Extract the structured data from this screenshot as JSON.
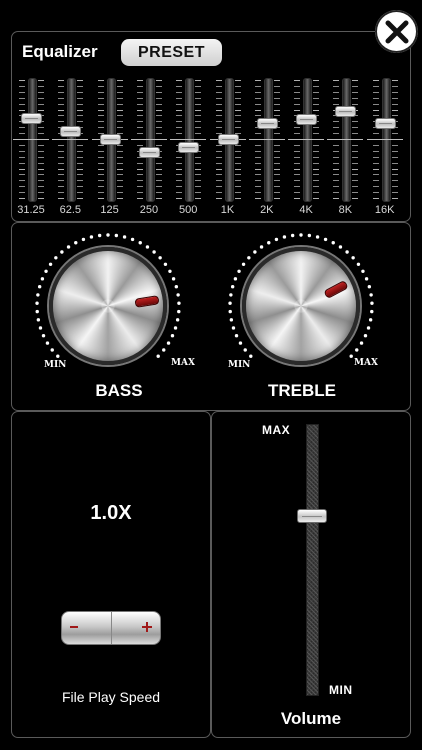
{
  "header": {
    "close_icon": "close-icon"
  },
  "equalizer": {
    "title": "Equalizer",
    "preset_label": "PRESET",
    "level_range": [
      -12,
      12
    ],
    "bands": [
      {
        "label": "31.25",
        "level": 4
      },
      {
        "label": "62.5",
        "level": 1.5
      },
      {
        "label": "125",
        "level": 0
      },
      {
        "label": "250",
        "level": -2.6
      },
      {
        "label": "500",
        "level": -1.6
      },
      {
        "label": "1K",
        "level": 0
      },
      {
        "label": "2K",
        "level": 3
      },
      {
        "label": "4K",
        "level": 3.8
      },
      {
        "label": "8K",
        "level": 5.5
      },
      {
        "label": "16K",
        "level": 3
      }
    ]
  },
  "bass": {
    "label": "BASS",
    "min_label": "MIN",
    "max_label": "MAX",
    "value": 0.8
  },
  "treble": {
    "label": "TREBLE",
    "min_label": "MIN",
    "max_label": "MAX",
    "value": 0.73
  },
  "speed": {
    "value": "1.0X",
    "label": "File Play Speed",
    "minus": "-",
    "plus": "+"
  },
  "volume": {
    "label": "Volume",
    "max_label": "MAX",
    "min_label": "MIN",
    "level": 0.66
  },
  "colors": {
    "background": "#000000",
    "panel_border": "#5a5a5a",
    "knob_dots": "#ffffff",
    "marker": "#b01818"
  }
}
